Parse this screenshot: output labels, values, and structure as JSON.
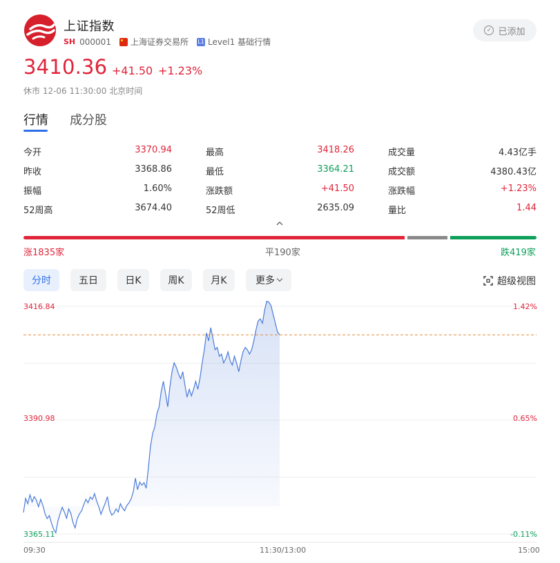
{
  "header": {
    "name": "上证指数",
    "market_tag": "SH",
    "code": "000001",
    "exchange": "上海证券交易所",
    "level_tag": "L1",
    "level_text": "Level1 基础行情",
    "added_label": "已添加"
  },
  "quote": {
    "price": "3410.36",
    "change": "+41.50",
    "change_pct": "+1.23%",
    "status": "休市 12-06 11:30:00 北京时间"
  },
  "tabs": [
    {
      "label": "行情",
      "active": true
    },
    {
      "label": "成分股",
      "active": false
    }
  ],
  "stats": [
    [
      {
        "label": "今开",
        "value": "3370.94",
        "tone": "red"
      },
      {
        "label": "最高",
        "value": "3418.26",
        "tone": "red"
      },
      {
        "label": "成交量",
        "value": "4.43亿手",
        "tone": "dark"
      }
    ],
    [
      {
        "label": "昨收",
        "value": "3368.86",
        "tone": "dark"
      },
      {
        "label": "最低",
        "value": "3364.21",
        "tone": "green"
      },
      {
        "label": "成交额",
        "value": "4380.43亿",
        "tone": "dark"
      }
    ],
    [
      {
        "label": "振幅",
        "value": "1.60%",
        "tone": "dark"
      },
      {
        "label": "涨跌额",
        "value": "+41.50",
        "tone": "red"
      },
      {
        "label": "涨跌幅",
        "value": "+1.23%",
        "tone": "red"
      }
    ],
    [
      {
        "label": "52周高",
        "value": "3674.40",
        "tone": "dark"
      },
      {
        "label": "52周低",
        "value": "2635.09",
        "tone": "dark"
      },
      {
        "label": "量比",
        "value": "1.44",
        "tone": "red"
      }
    ]
  ],
  "breadth": {
    "up": "涨1835家",
    "flat": "平190家",
    "down": "跌419家"
  },
  "periods": [
    {
      "label": "分时",
      "active": true
    },
    {
      "label": "五日",
      "active": false
    },
    {
      "label": "日K",
      "active": false
    },
    {
      "label": "周K",
      "active": false
    },
    {
      "label": "月K",
      "active": false
    },
    {
      "label": "更多",
      "active": false
    }
  ],
  "super_view_label": "超级视图",
  "colors": {
    "up": "#e0243a",
    "down": "#0e9f5a",
    "accent": "#2d6ee8",
    "line": "#4a7ad8"
  },
  "chart_data": {
    "type": "area",
    "y_labels_left": [
      "3416.84",
      "3390.98",
      "3365.11"
    ],
    "y_labels_right": [
      "1.42%",
      "0.65%",
      "-0.11%"
    ],
    "x_labels": [
      "09:30",
      "11:30/13:00",
      "15:00"
    ],
    "ylim": [
      3365.11,
      3416.84
    ],
    "prev_close": 3368.86,
    "last_price": 3410.36,
    "grid": true,
    "x_total_minutes": 240,
    "series": [
      {
        "values": [
          3370.0,
          3373.2,
          3372.0,
          3374.0,
          3372.4,
          3373.6,
          3372.8,
          3371.3,
          3373.0,
          3371.6,
          3369.7,
          3368.6,
          3369.3,
          3367.6,
          3366.2,
          3365.4,
          3368.1,
          3369.7,
          3371.2,
          3370.1,
          3368.7,
          3370.8,
          3369.8,
          3367.7,
          3366.5,
          3368.6,
          3369.7,
          3370.4,
          3371.8,
          3373.0,
          3372.2,
          3373.5,
          3373.0,
          3374.3,
          3372.6,
          3371.3,
          3369.6,
          3370.9,
          3372.2,
          3373.6,
          3370.6,
          3369.4,
          3369.8,
          3370.8,
          3370.1,
          3372.0,
          3371.0,
          3370.4,
          3371.6,
          3372.2,
          3373.1,
          3374.7,
          3377.8,
          3375.2,
          3376.9,
          3376.2,
          3376.8,
          3375.5,
          3380.0,
          3385.0,
          3388.0,
          3389.5,
          3392.5,
          3394.0,
          3397.5,
          3399.8,
          3397.0,
          3394.0,
          3398.5,
          3402.0,
          3404.0,
          3403.0,
          3401.5,
          3400.4,
          3402.0,
          3399.0,
          3396.2,
          3398.0,
          3396.5,
          3398.0,
          3399.8,
          3398.0,
          3400.5,
          3404.0,
          3407.0,
          3410.8,
          3409.0,
          3412.0,
          3409.5,
          3407.0,
          3407.5,
          3405.5,
          3406.0,
          3404.0,
          3405.0,
          3406.5,
          3404.5,
          3403.5,
          3405.5,
          3404.0,
          3402.0,
          3404.5,
          3406.5,
          3407.5,
          3407.0,
          3406.0,
          3407.0,
          3409.0,
          3411.5,
          3413.5,
          3414.0,
          3413.0,
          3416.0,
          3418.0,
          3417.8,
          3417.0,
          3415.0,
          3413.0,
          3411.0,
          3410.36
        ]
      }
    ]
  }
}
